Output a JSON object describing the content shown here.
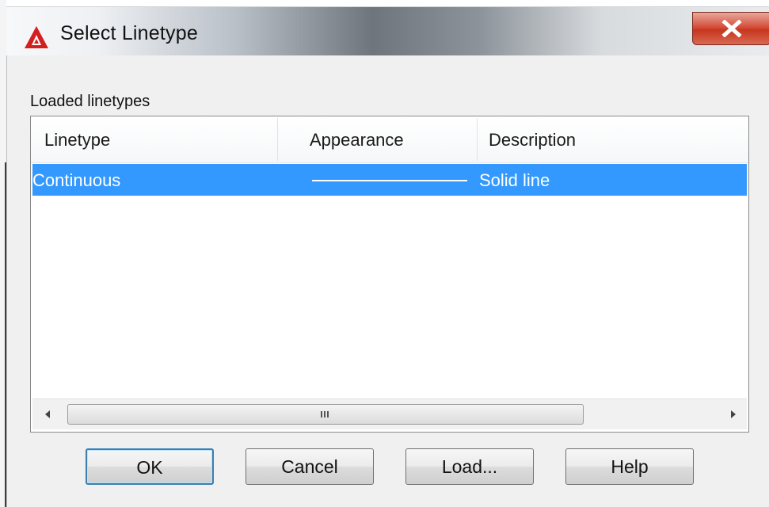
{
  "window": {
    "title": "Select Linetype",
    "app_icon": "autocad-a-icon",
    "close_icon": "close-x-icon"
  },
  "group": {
    "label": "Loaded linetypes"
  },
  "list": {
    "columns": [
      "Linetype",
      "Appearance",
      "Description"
    ],
    "rows": [
      {
        "linetype": "Continuous",
        "appearance": "solid-line-sample",
        "description": "Solid line",
        "selected": true
      }
    ],
    "scroll_grip": "III"
  },
  "buttons": {
    "ok": "OK",
    "cancel": "Cancel",
    "load": "Load...",
    "help": "Help"
  },
  "colors": {
    "selection": "#3399ff",
    "close_button": "#c7361f",
    "app_icon_red": "#d41f1f"
  }
}
